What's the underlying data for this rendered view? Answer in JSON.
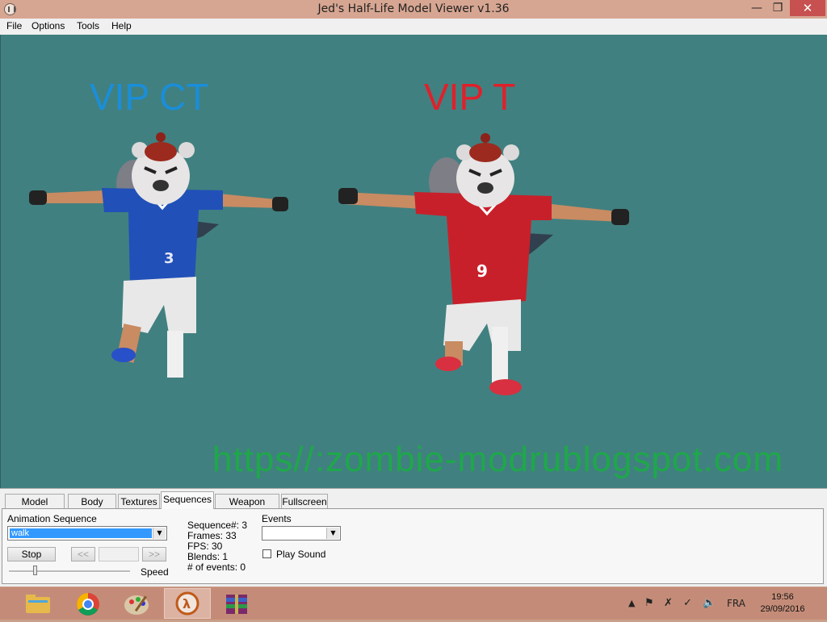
{
  "window": {
    "title": "Jed's Half-Life Model Viewer v1.36"
  },
  "menu": {
    "items": [
      "File",
      "Options",
      "Tools",
      "Help"
    ]
  },
  "viewport": {
    "labels": {
      "ct": "VIP CT",
      "t": "VIP T"
    },
    "watermark": "https//:zombie-modrublogspot.com",
    "background": "#418080",
    "models": [
      {
        "name": "ct",
        "jersey_number": "3",
        "jersey_color": "#2150b8"
      },
      {
        "name": "t",
        "jersey_number": "9",
        "jersey_color": "#c8202a"
      }
    ]
  },
  "tabs": [
    "Model Display",
    "Body Parts",
    "Textures",
    "Sequences",
    "Weapon Origin",
    "Fullscreen"
  ],
  "active_tab": "Sequences",
  "sequences": {
    "animation_label": "Animation Sequence",
    "animation_value": "walk",
    "stop_label": "Stop",
    "prev_label": "<<",
    "next_label": ">>",
    "speed_label": "Speed",
    "speed_level": 0.2,
    "info": [
      "Sequence#: 3",
      "Frames: 33",
      "FPS: 30",
      "Blends: 1",
      "# of events: 0"
    ],
    "events_label": "Events",
    "events_value": "",
    "play_sound_label": "Play Sound",
    "play_sound_checked": false
  },
  "taskbar": {
    "apps": [
      "file-explorer-icon",
      "chrome-icon",
      "paint-icon",
      "half-life-icon",
      "winrar-icon"
    ],
    "active_app": "half-life-icon",
    "language": "FRA",
    "time": "19:56",
    "date": "29/09/2016"
  }
}
